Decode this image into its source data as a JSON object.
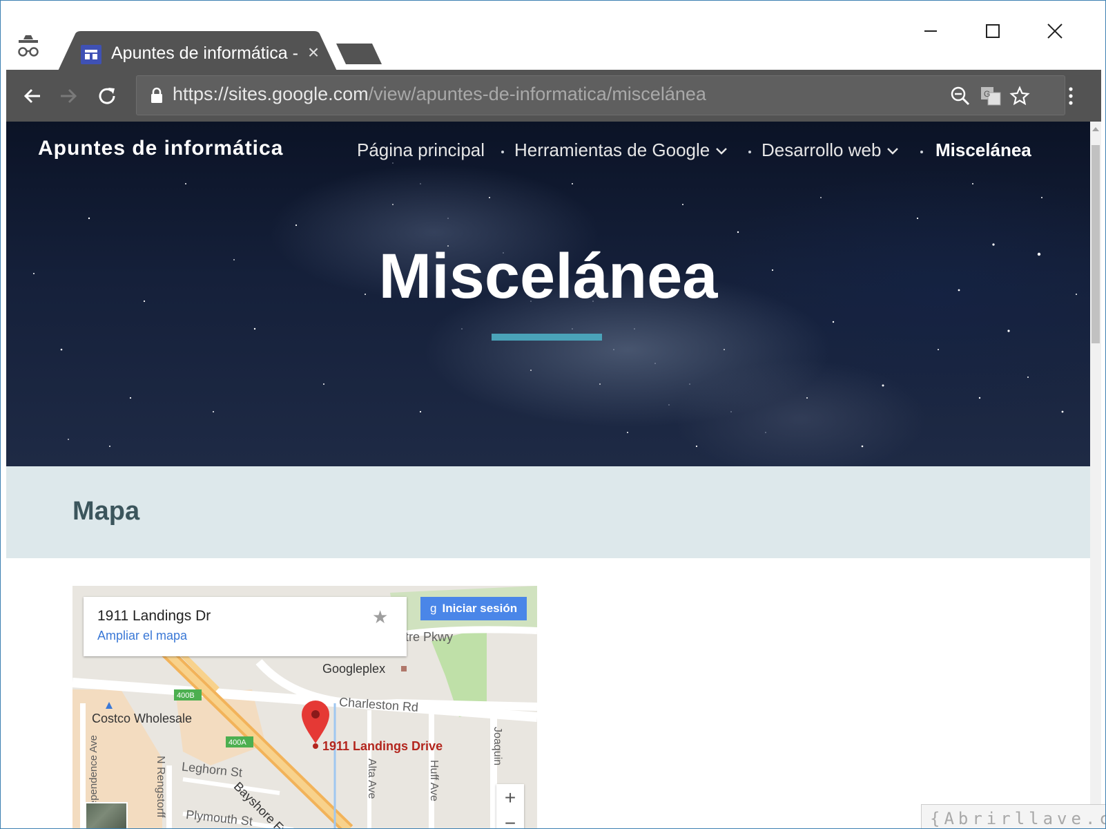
{
  "browser": {
    "tab_title": "Apuntes de informática -",
    "url_host": "https://sites.google.com",
    "url_path": "/view/apuntes-de-informatica/miscelánea"
  },
  "site": {
    "title": "Apuntes de informática",
    "nav": [
      {
        "label": "Página principal"
      },
      {
        "label": "Herramientas de Google"
      },
      {
        "label": "Desarrollo web"
      },
      {
        "label": "Miscelánea"
      }
    ],
    "hero_title": "Miscelánea",
    "section_title": "Mapa"
  },
  "map": {
    "address": "1911 Landings Dr",
    "enlarge_link": "Ampliar el mapa",
    "signin_icon": "g",
    "signin_label": "Iniciar sesión",
    "labels": {
      "googleplex": "Googleplex",
      "charleston": "Charleston Rd",
      "costco": "Costco Wholesale",
      "pin_label": "1911 Landings Drive",
      "leghorn": "Leghorn St",
      "bayshore": "Bayshore Fwy",
      "plymouth": "Plymouth St",
      "independence": "Independence Ave",
      "rengstorff": "N Rengstorff",
      "alta": "Alta Ave",
      "huff": "Huff Ave",
      "joaquin": "Joaquin",
      "amphitheatre": "atre Pkwy",
      "exit_400b": "400B",
      "exit_400a": "400A"
    },
    "zoom_in": "+",
    "zoom_out": "−"
  },
  "watermark": "{Abrirllave.com",
  "colors": {
    "accent_rule": "#4aa3b9",
    "section_bg": "#dde8eb",
    "signin_bg": "#4a86e8",
    "pin": "#e53935"
  }
}
